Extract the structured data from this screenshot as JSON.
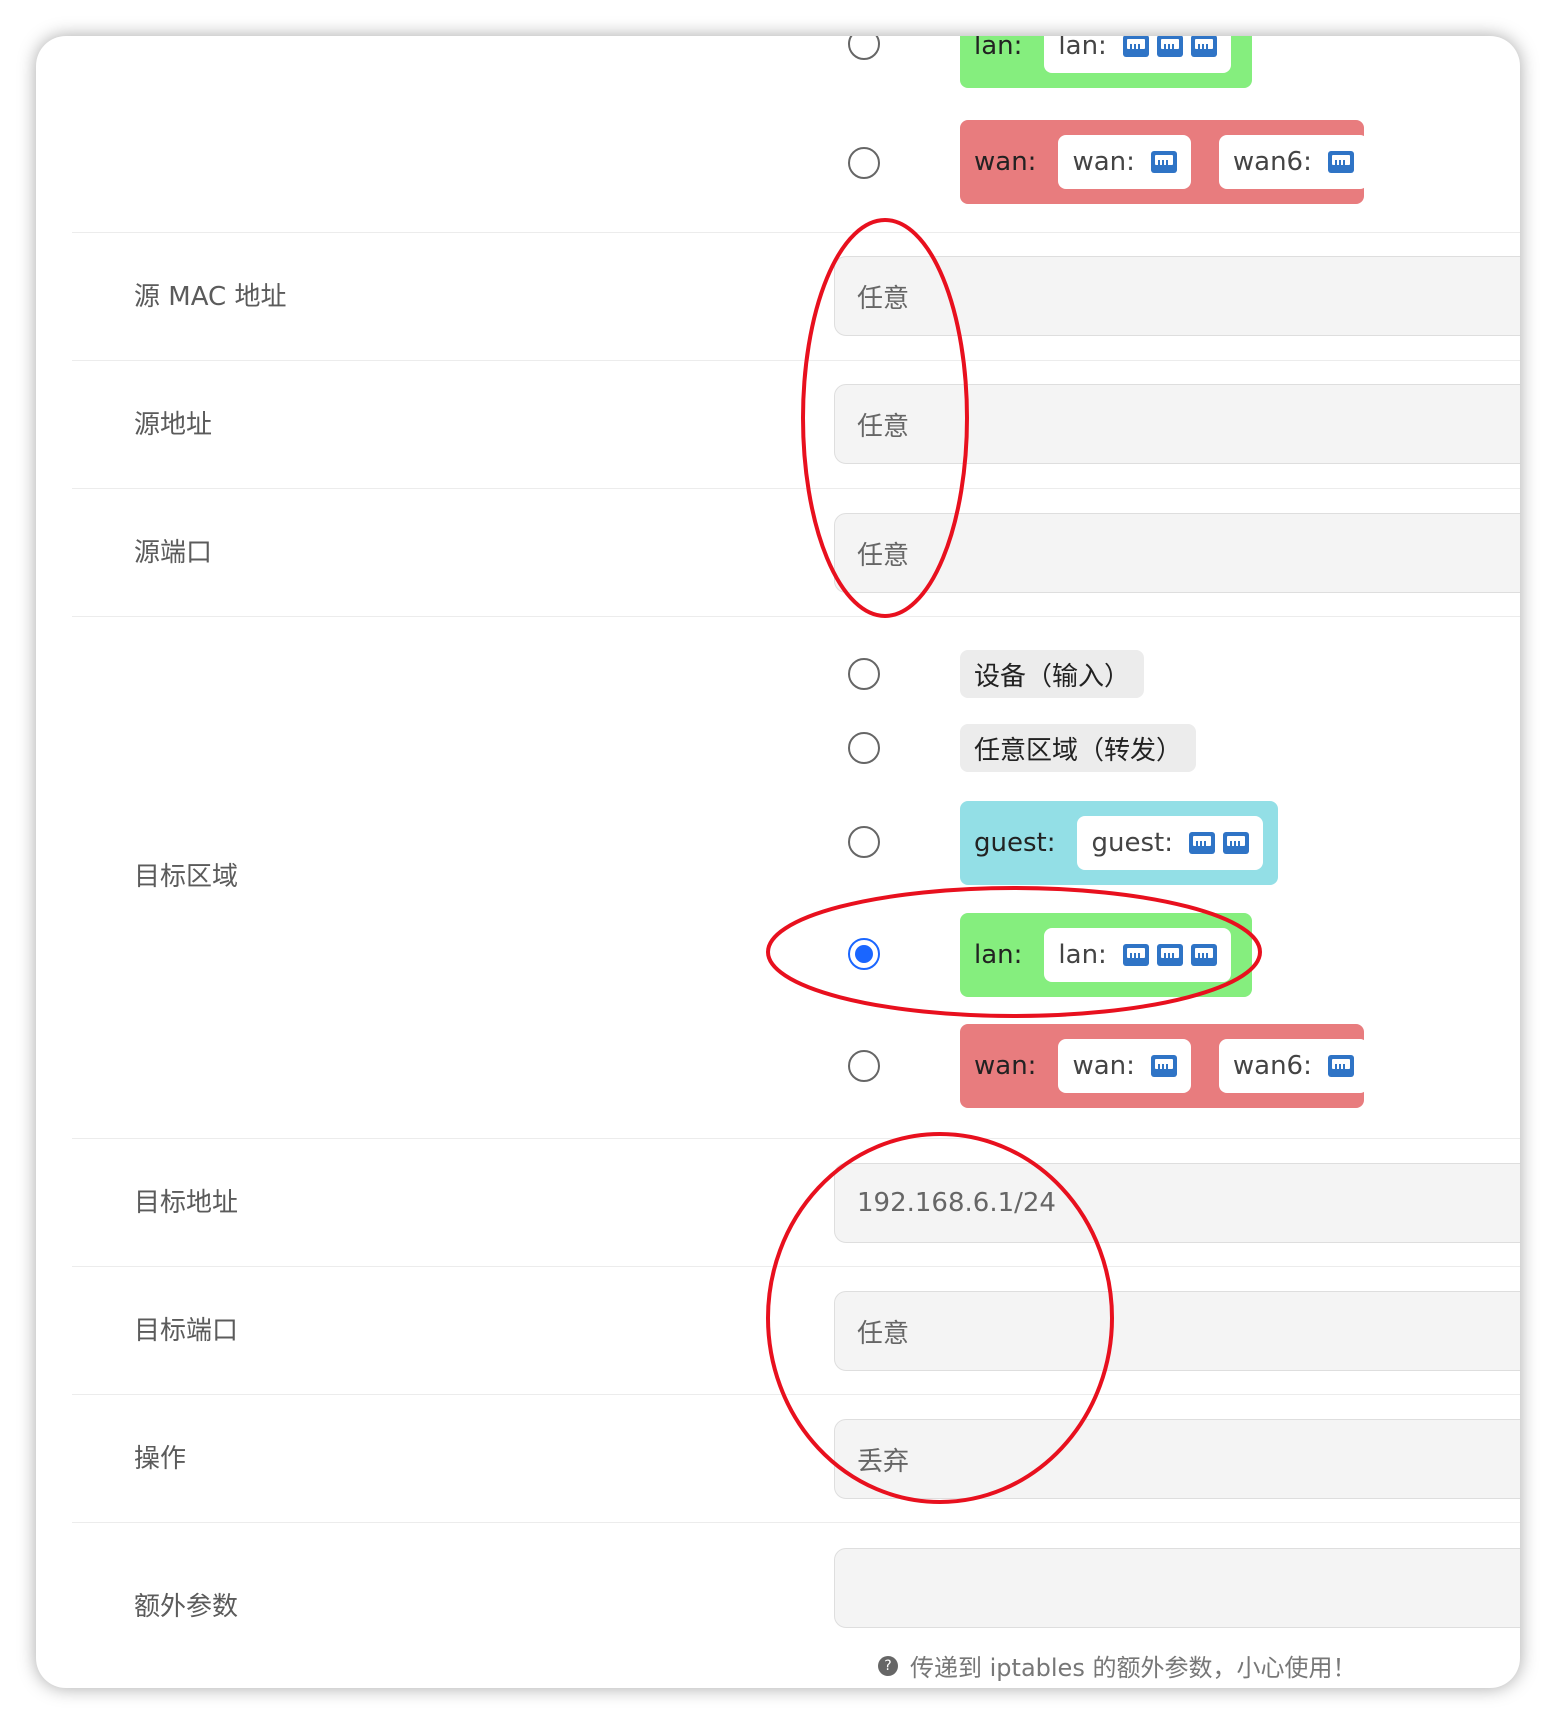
{
  "top_zones": {
    "lan": {
      "name": "lan:",
      "ifaces": [
        {
          "label": "lan:",
          "ports": 3
        }
      ]
    },
    "wan": {
      "name": "wan:",
      "ifaces": [
        {
          "label": "wan:",
          "ports": 1
        },
        {
          "label": "wan6:",
          "ports": 1
        }
      ]
    }
  },
  "source": {
    "mac": {
      "label": "源 MAC 地址",
      "value": "任意"
    },
    "address": {
      "label": "源地址",
      "value": "任意"
    },
    "port": {
      "label": "源端口",
      "value": "任意"
    }
  },
  "dest_zone": {
    "label": "目标区域",
    "options": [
      {
        "name": "设备（输入）"
      },
      {
        "name": "任意区域（转发）"
      },
      {
        "name": "guest:",
        "ifaces": [
          {
            "label": "guest:",
            "ports": 2
          }
        ]
      },
      {
        "name": "lan:",
        "ifaces": [
          {
            "label": "lan:",
            "ports": 3
          }
        ],
        "selected": true
      },
      {
        "name": "wan:",
        "ifaces": [
          {
            "label": "wan:",
            "ports": 1
          },
          {
            "label": "wan6:",
            "ports": 1
          }
        ]
      }
    ]
  },
  "dest": {
    "address": {
      "label": "目标地址",
      "value": "192.168.6.1/24"
    },
    "port": {
      "label": "目标端口",
      "value": "任意"
    }
  },
  "action": {
    "label": "操作",
    "value": "丢弃"
  },
  "extra": {
    "label": "额外参数",
    "value": "",
    "hint": "传递到 iptables 的额外参数，小心使用！"
  },
  "colors": {
    "lan": "#85ee7e",
    "wan": "#e87c7e",
    "guest": "#93dfe6",
    "radio_selected": "#1a66ff",
    "annotation": "#e8101e"
  }
}
